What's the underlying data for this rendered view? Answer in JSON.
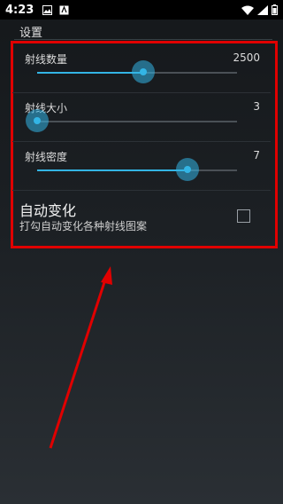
{
  "status": {
    "time": "4:23",
    "left_icons": [
      "image-icon",
      "app-icon"
    ],
    "right_icons": [
      "wifi-icon",
      "signal-icon",
      "battery-icon"
    ]
  },
  "header": {
    "title": "设置"
  },
  "settings": {
    "sliders": [
      {
        "label": "射线数量",
        "value": "2500",
        "level": 0.53
      },
      {
        "label": "射线大小",
        "value": "3",
        "level": 0.0
      },
      {
        "label": "射线密度",
        "value": "7",
        "level": 0.75
      }
    ],
    "auto": {
      "title": "自动变化",
      "subtitle": "打勾自动变化各种射线图案",
      "checked": false
    }
  },
  "colors": {
    "accent": "#33b5e5",
    "highlight_box": "#e00000",
    "annotation_arrow": "#e00000"
  }
}
